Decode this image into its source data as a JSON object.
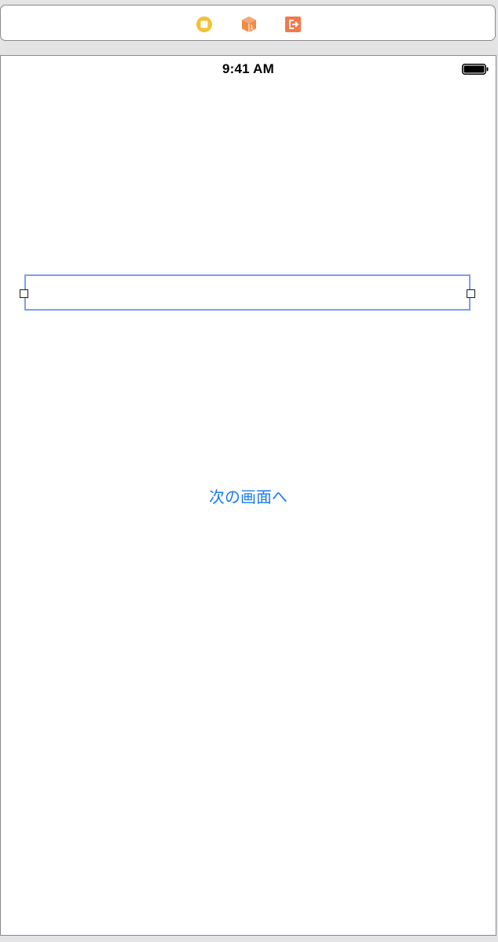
{
  "scene_dock": {
    "icons": [
      "view-controller-icon",
      "first-responder-icon",
      "exit-icon"
    ],
    "colors": {
      "view_controller": "#f1c232",
      "first_responder": "#f08a4b",
      "exit": "#f07a4a"
    }
  },
  "status_bar": {
    "time": "9:41 AM"
  },
  "text_field": {
    "value": "",
    "border_color": "#7d9ef4"
  },
  "main": {
    "next_button_label": "次の画面へ",
    "accent_color": "#1a7cf5"
  }
}
